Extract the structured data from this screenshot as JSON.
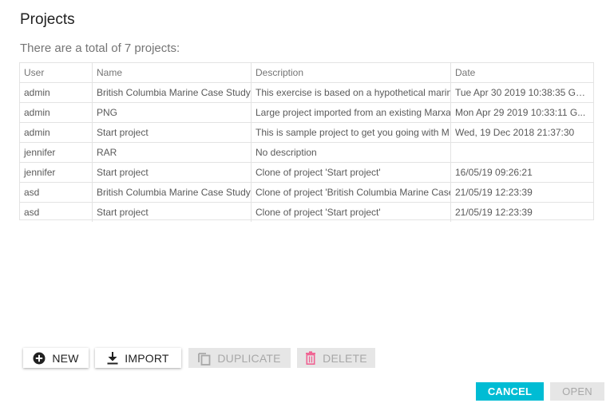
{
  "dialog": {
    "title": "Projects",
    "subtitle": "There are a total of 7 projects:"
  },
  "table": {
    "columns": [
      "User",
      "Name",
      "Description",
      "Date"
    ],
    "rows": [
      {
        "user": "admin",
        "name": "British Columbia Marine Case Study",
        "description": "This exercise is based on a hypothetical marin",
        "date": "Tue Apr 30 2019 10:38:35 GM..."
      },
      {
        "user": "admin",
        "name": "PNG",
        "description": "Large project imported from an existing Marxa",
        "date": "Mon Apr 29 2019 10:33:11 G..."
      },
      {
        "user": "admin",
        "name": "Start project",
        "description": "This is sample project to get you going with M",
        "date": "Wed, 19 Dec 2018 21:37:30"
      },
      {
        "user": "jennifer",
        "name": "RAR",
        "description": "No description",
        "date": ""
      },
      {
        "user": "jennifer",
        "name": "Start project",
        "description": "Clone of project 'Start project'",
        "date": "16/05/19 09:26:21"
      },
      {
        "user": "asd",
        "name": "British Columbia Marine Case Study",
        "description": "Clone of project 'British Columbia Marine Case",
        "date": "21/05/19 12:23:39"
      },
      {
        "user": "asd",
        "name": "Start project",
        "description": "Clone of project 'Start project'",
        "date": "21/05/19 12:23:39"
      }
    ]
  },
  "toolbar": {
    "new_label": "NEW",
    "import_label": "IMPORT",
    "duplicate_label": "DUPLICATE",
    "delete_label": "DELETE"
  },
  "actions": {
    "cancel_label": "CANCEL",
    "open_label": "OPEN"
  },
  "icons": {
    "new": "add-circle-icon",
    "import": "download-icon",
    "duplicate": "copy-icon",
    "delete": "trash-icon"
  },
  "colors": {
    "accent": "#00bcd4",
    "delete_icon": "#f06292",
    "disabled_bg": "#e6e6e6"
  }
}
